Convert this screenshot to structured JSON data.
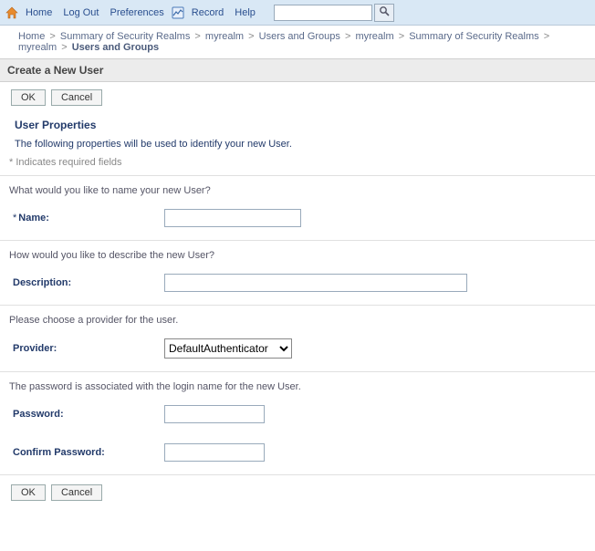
{
  "topbar": {
    "home": "Home",
    "logout": "Log Out",
    "preferences": "Preferences",
    "record": "Record",
    "help": "Help",
    "search_value": "",
    "search_placeholder": ""
  },
  "breadcrumb": {
    "items": [
      "Home",
      "Summary of Security Realms",
      "myrealm",
      "Users and Groups",
      "myrealm",
      "Summary of Security Realms",
      "myrealm"
    ],
    "current": "Users and Groups"
  },
  "page": {
    "title": "Create a New User",
    "ok": "OK",
    "cancel": "Cancel"
  },
  "section": {
    "header": "User Properties",
    "desc": "The following properties will be used to identify your new User.",
    "required_note": "* Indicates required fields"
  },
  "form": {
    "name_prompt": "What would you like to name your new User?",
    "name_label": "Name:",
    "name_value": "",
    "desc_prompt": "How would you like to describe the new User?",
    "desc_label": "Description:",
    "desc_value": "",
    "provider_prompt": "Please choose a provider for the user.",
    "provider_label": "Provider:",
    "provider_selected": "DefaultAuthenticator",
    "password_prompt": "The password is associated with the login name for the new User.",
    "password_label": "Password:",
    "password_value": "",
    "confirm_label": "Confirm Password:",
    "confirm_value": ""
  }
}
